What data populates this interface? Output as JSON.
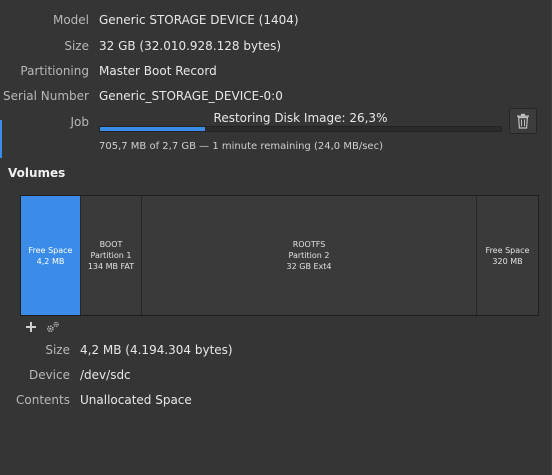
{
  "drive": {
    "model_label": "Model",
    "model": "Generic STORAGE DEVICE (1404)",
    "size_label": "Size",
    "size": "32 GB (32.010.928.128 bytes)",
    "partitioning_label": "Partitioning",
    "partitioning": "Master Boot Record",
    "serial_label": "Serial Number",
    "serial": "Generic_STORAGE_DEVICE-0:0",
    "job_label": "Job"
  },
  "job": {
    "title": "Restoring Disk Image: 26,3%",
    "progress_fraction": 0.263,
    "status": "705,7 MB of 2,7 GB — 1 minute remaining (24,0 MB/sec)",
    "cancel_icon": "trash-icon"
  },
  "volumes": {
    "section_title": "Volumes",
    "segments": [
      {
        "line1": "Free Space",
        "line2": "4,2 MB",
        "line3": "",
        "selected": true
      },
      {
        "line1": "BOOT",
        "line2": "Partition 1",
        "line3": "134 MB FAT",
        "selected": false
      },
      {
        "line1": "ROOTFS",
        "line2": "Partition 2",
        "line3": "32 GB Ext4",
        "selected": false
      },
      {
        "line1": "Free Space",
        "line2": "320 MB",
        "line3": "",
        "selected": false
      }
    ],
    "tools": [
      "plus-icon",
      "gears-icon"
    ]
  },
  "selected_volume": {
    "size_label": "Size",
    "size": "4,2 MB (4.194.304 bytes)",
    "device_label": "Device",
    "device": "/dev/sdc",
    "contents_label": "Contents",
    "contents": "Unallocated Space"
  },
  "colors": {
    "accent": "#3a8ce8",
    "background": "#353535"
  }
}
